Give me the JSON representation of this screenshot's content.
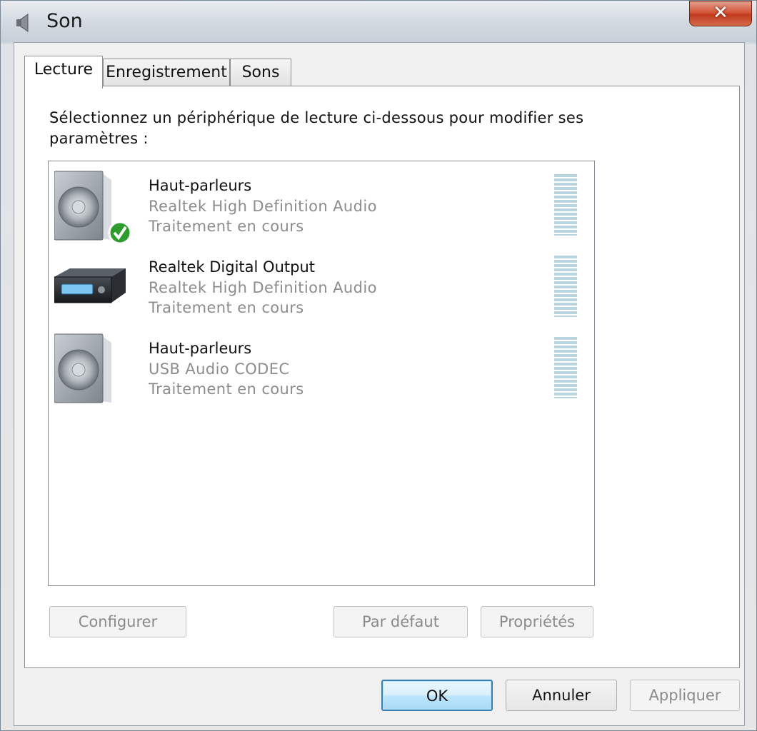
{
  "window": {
    "title": "Son",
    "close_label": "✕"
  },
  "tabs": [
    {
      "label": "Lecture",
      "active": true
    },
    {
      "label": "Enregistrement",
      "active": false
    },
    {
      "label": "Sons",
      "active": false
    }
  ],
  "instruction": "Sélectionnez un périphérique de lecture ci-dessous pour modifier ses paramètres :",
  "devices": [
    {
      "name": "Haut-parleurs",
      "driver": "Realtek High Definition Audio",
      "status": "Traitement en cours",
      "icon": "speaker-icon",
      "is_default": true
    },
    {
      "name": "Realtek Digital Output",
      "driver": "Realtek High Definition Audio",
      "status": "Traitement en cours",
      "icon": "digital-output-icon",
      "is_default": false
    },
    {
      "name": "Haut-parleurs",
      "driver": "USB Audio CODEC",
      "status": "Traitement en cours",
      "icon": "speaker-icon",
      "is_default": false
    }
  ],
  "panel_buttons": {
    "configure": "Configurer",
    "set_default": "Par défaut",
    "properties": "Propriétés"
  },
  "dialog_buttons": {
    "ok": "OK",
    "cancel": "Annuler",
    "apply": "Appliquer"
  },
  "colors": {
    "meter": "#b9d3df",
    "disabled_text": "#8a8a8a",
    "default_button_border": "#3c7fb1"
  }
}
